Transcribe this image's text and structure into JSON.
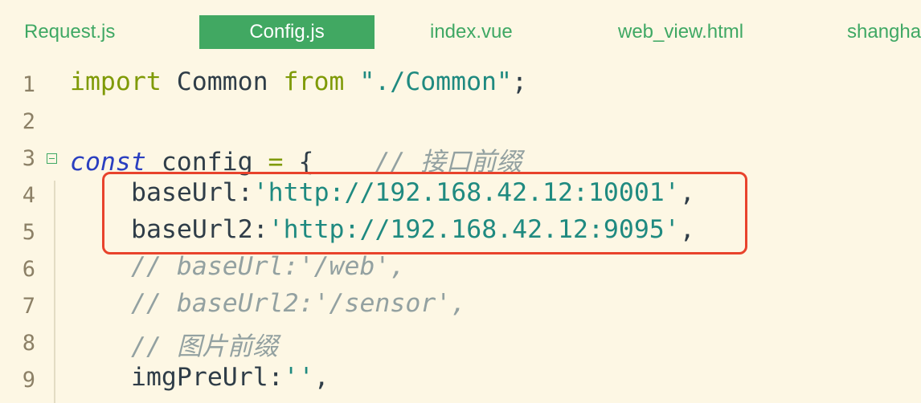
{
  "tabs": [
    {
      "label": "Request.js",
      "active": false
    },
    {
      "label": "Config.js",
      "active": true
    },
    {
      "label": "index.vue",
      "active": false
    },
    {
      "label": "web_view.html",
      "active": false
    },
    {
      "label": "shanghai",
      "active": false
    }
  ],
  "colors": {
    "active_tab": "#41a862",
    "highlight_box": "#e8432c",
    "background": "#fdf7e4"
  },
  "lines": [
    {
      "num": "1",
      "indent": 0,
      "tokens": [
        [
          "import",
          "kw"
        ],
        [
          " Common ",
          ""
        ],
        [
          "from",
          "kw"
        ],
        [
          " \"./Common\"",
          "str"
        ],
        [
          ";",
          ""
        ]
      ]
    },
    {
      "num": "2",
      "indent": 0,
      "tokens": []
    },
    {
      "num": "3",
      "indent": 0,
      "fold": true,
      "tokens": [
        [
          "const",
          "decl"
        ],
        [
          " config ",
          ""
        ],
        [
          "=",
          "op"
        ],
        [
          " {    ",
          ""
        ],
        [
          "// 接口前缀",
          "cm"
        ]
      ]
    },
    {
      "num": "4",
      "indent": 4,
      "tokens": [
        [
          "baseUrl:",
          ""
        ],
        [
          "'http://192.168.42.12:10001'",
          "str"
        ],
        [
          ",",
          ""
        ]
      ]
    },
    {
      "num": "5",
      "indent": 4,
      "tokens": [
        [
          "baseUrl2:",
          ""
        ],
        [
          "'http://192.168.42.12:9095'",
          "str"
        ],
        [
          ",",
          ""
        ]
      ]
    },
    {
      "num": "6",
      "indent": 4,
      "tokens": [
        [
          "// baseUrl:'/web',",
          "cm"
        ]
      ]
    },
    {
      "num": "7",
      "indent": 4,
      "tokens": [
        [
          "// baseUrl2:'/sensor',",
          "cm"
        ]
      ]
    },
    {
      "num": "8",
      "indent": 4,
      "tokens": [
        [
          "// 图片前缀",
          "cm"
        ]
      ]
    },
    {
      "num": "9",
      "indent": 4,
      "tokens": [
        [
          "imgPreUrl:",
          ""
        ],
        [
          "''",
          "str"
        ],
        [
          ",",
          ""
        ]
      ]
    }
  ]
}
